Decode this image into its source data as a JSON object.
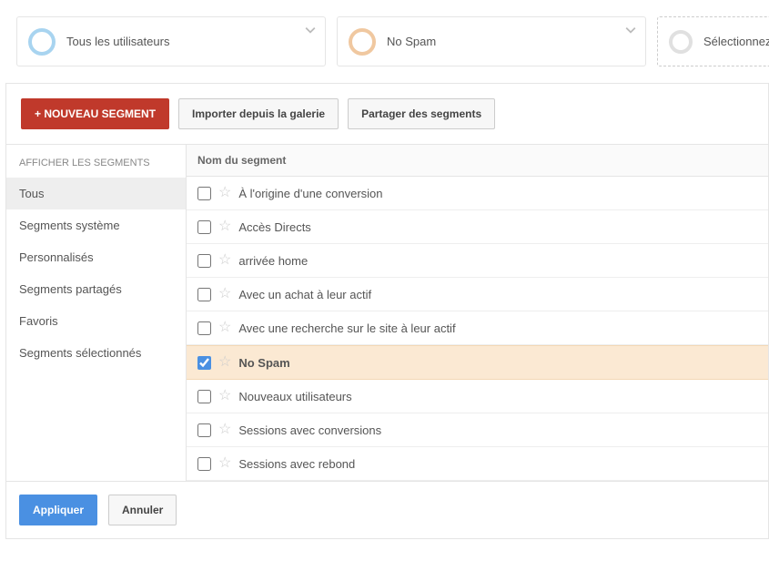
{
  "segmentCards": [
    {
      "label": "Tous les utilisateurs",
      "color": "blue"
    },
    {
      "label": "No Spam",
      "color": "orange"
    },
    {
      "label": "Sélectionnez",
      "color": "gray",
      "dashed": true
    }
  ],
  "toolbar": {
    "newSegment": "+ NOUVEAU SEGMENT",
    "importGallery": "Importer depuis la galerie",
    "shareSegments": "Partager des segments"
  },
  "sidebar": {
    "header": "AFFICHER LES SEGMENTS",
    "items": [
      {
        "label": "Tous",
        "active": true
      },
      {
        "label": "Segments système"
      },
      {
        "label": "Personnalisés"
      },
      {
        "label": "Segments partagés"
      },
      {
        "label": "Favoris"
      },
      {
        "label": "Segments sélectionnés"
      }
    ]
  },
  "table": {
    "columnHeader": "Nom du segment",
    "rows": [
      {
        "label": "À l'origine d'une conversion",
        "checked": false
      },
      {
        "label": "Accès Directs",
        "checked": false
      },
      {
        "label": "arrivée home",
        "checked": false
      },
      {
        "label": "Avec un achat à leur actif",
        "checked": false
      },
      {
        "label": "Avec une recherche sur le site à leur actif",
        "checked": false
      },
      {
        "label": "No Spam",
        "checked": true
      },
      {
        "label": "Nouveaux utilisateurs",
        "checked": false
      },
      {
        "label": "Sessions avec conversions",
        "checked": false
      },
      {
        "label": "Sessions avec rebond",
        "checked": false
      }
    ]
  },
  "footer": {
    "apply": "Appliquer",
    "cancel": "Annuler"
  }
}
